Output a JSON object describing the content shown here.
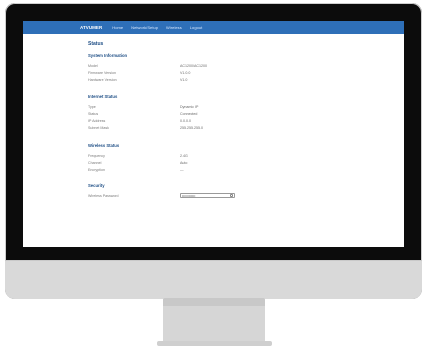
{
  "browser_ui": {
    "brand": "ATVUMER",
    "nav": [
      "Home",
      "Network/Setup",
      "Wireless",
      "Logout"
    ]
  },
  "page": {
    "title": "Status"
  },
  "sections": [
    {
      "title": "System Information",
      "rows": [
        {
          "label": "Model",
          "value": "AC1200/AC1200"
        },
        {
          "label": "Firmware Version",
          "value": "V1.0.0"
        },
        {
          "label": "Hardware Version",
          "value": "V1.0"
        }
      ]
    },
    {
      "title": "Internet Status",
      "rows": [
        {
          "label": "Type",
          "value": "Dynamic IP"
        },
        {
          "label": "Status",
          "value": "Connected"
        },
        {
          "label": "IP Address",
          "value": "0.0.0.0"
        },
        {
          "label": "Subnet Mask",
          "value": "255.255.255.0"
        }
      ]
    },
    {
      "title": "Wireless Status",
      "rows": [
        {
          "label": "Frequency",
          "value": "2.4G"
        },
        {
          "label": "Channel",
          "value": "Auto"
        },
        {
          "label": "Encryption",
          "value": "—"
        }
      ]
    },
    {
      "title": "Security",
      "rows": [
        {
          "label": "Wireless Password",
          "value": "••••••••••••"
        }
      ]
    }
  ]
}
